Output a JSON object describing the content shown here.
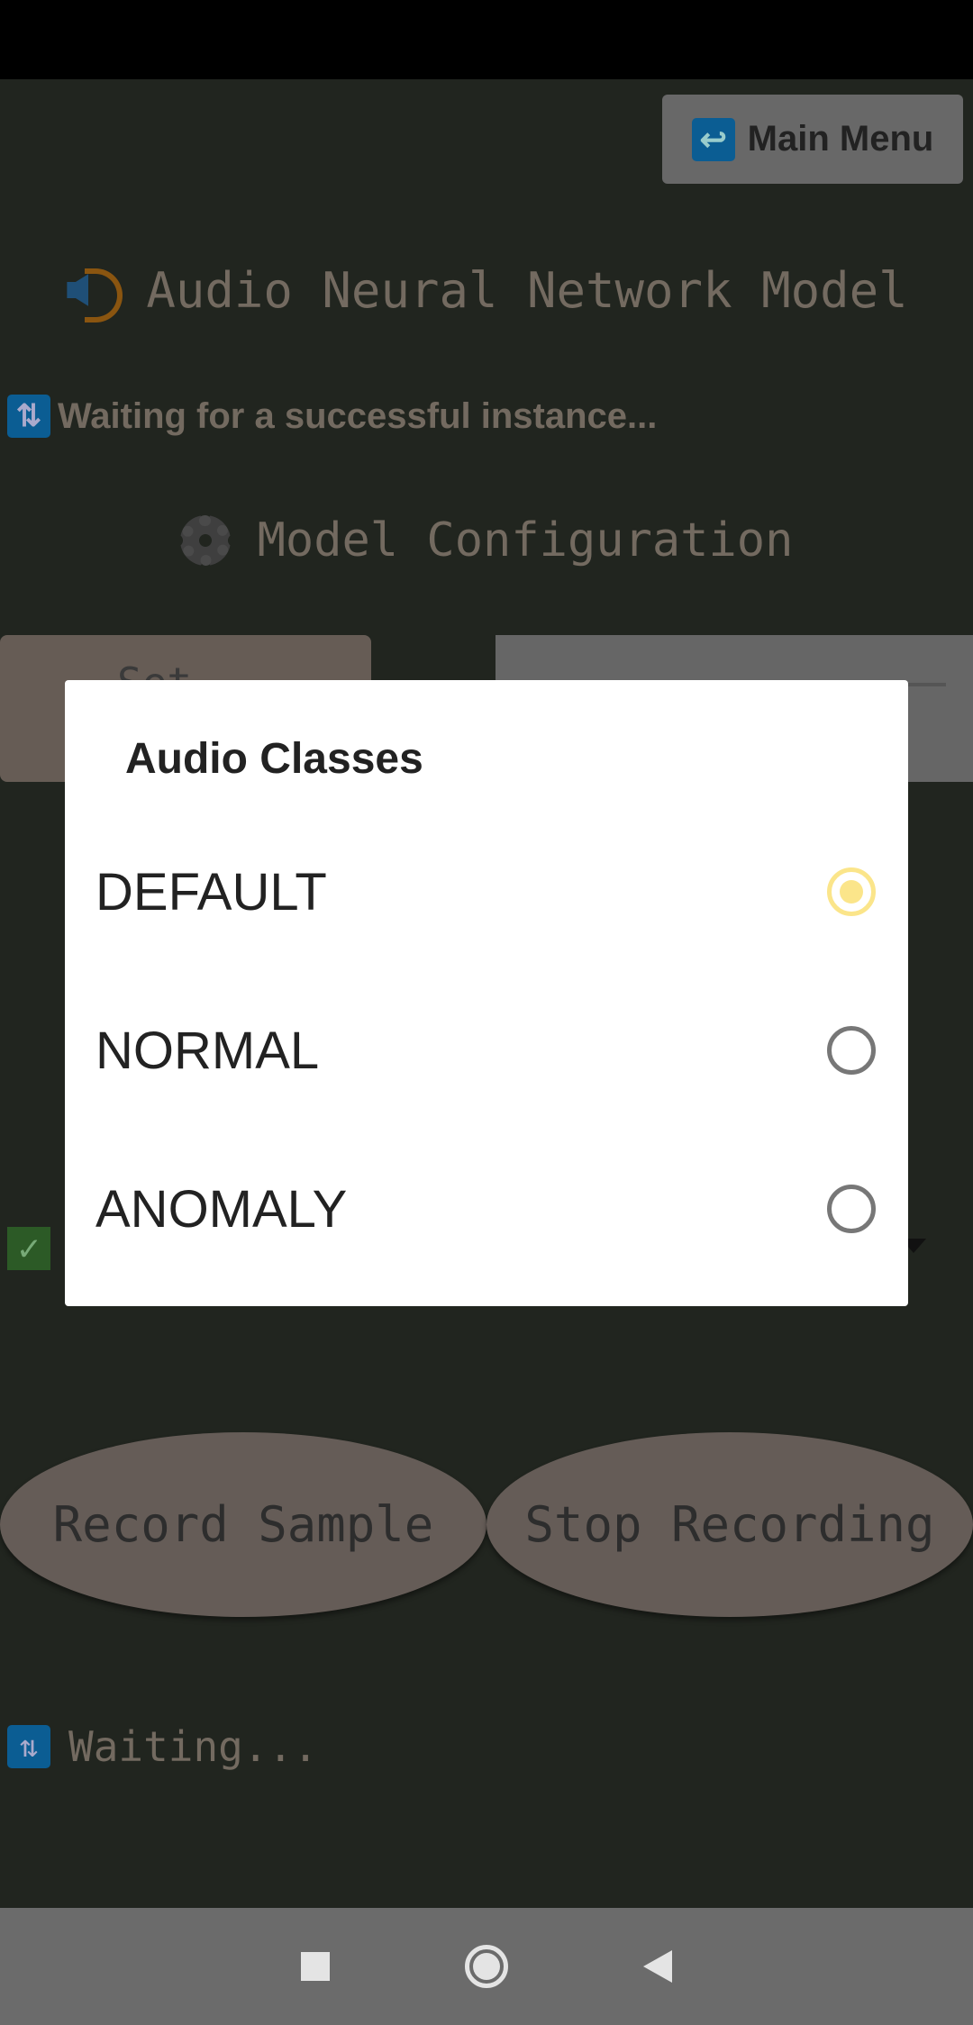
{
  "header": {
    "main_menu_label": "Main Menu",
    "title": "Audio Neural Network Model",
    "status": "Waiting for a successful instance...",
    "section_title": "Model Configuration"
  },
  "background": {
    "set_button_label": "Set",
    "record_label": "Record Sample",
    "stop_label": "Stop Recording",
    "recording_status": "Waiting..."
  },
  "dialog": {
    "title": "Audio Classes",
    "options": [
      {
        "label": "DEFAULT",
        "selected": true
      },
      {
        "label": "NORMAL",
        "selected": false
      },
      {
        "label": "ANOMALY",
        "selected": false
      }
    ],
    "accent": "#fbe58a"
  },
  "icons": {
    "back": "return-arrow-icon",
    "speaker": "speaker-icon",
    "sync": "sync-arrows-icon",
    "gear": "gear-icon",
    "check": "check-mark-icon"
  }
}
